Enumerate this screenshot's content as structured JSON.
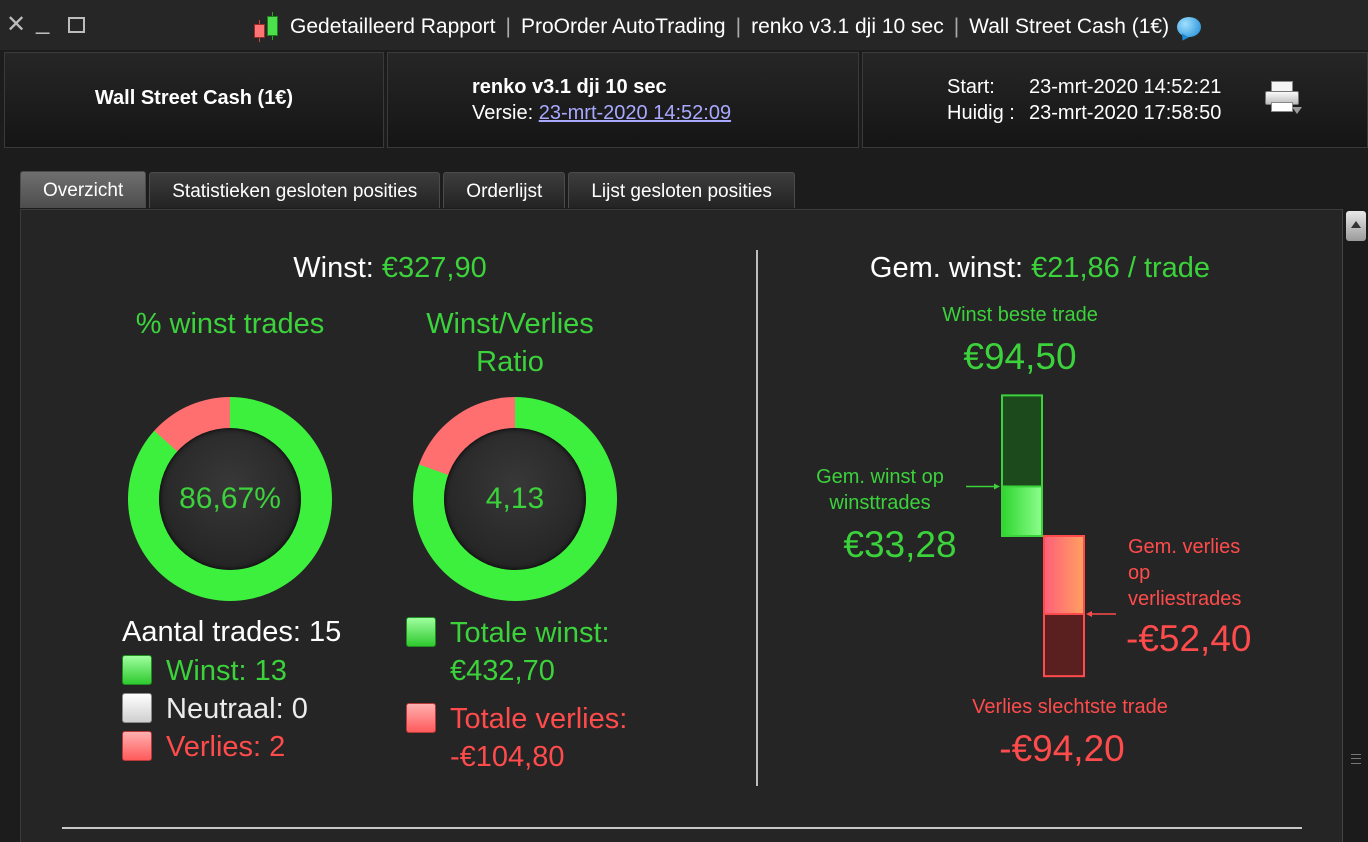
{
  "window": {
    "title_parts": [
      "Gedetailleerd Rapport",
      "ProOrder AutoTrading",
      "renko v3.1 dji 10 sec",
      "Wall Street Cash (1€)"
    ],
    "separator": "|"
  },
  "header": {
    "instrument": "Wall Street Cash (1€)",
    "strategy_name": "renko v3.1 dji 10 sec",
    "version_label": "Versie:",
    "version_value": "23-mrt-2020 14:52:09",
    "start_label": "Start:",
    "start_value": "23-mrt-2020 14:52:21",
    "current_label": "Huidig :",
    "current_value": "23-mrt-2020 17:58:50"
  },
  "tabs": [
    {
      "label": "Overzicht",
      "active": true
    },
    {
      "label": "Statistieken gesloten posities",
      "active": false
    },
    {
      "label": "Orderlijst",
      "active": false
    },
    {
      "label": "Lijst gesloten posities",
      "active": false
    }
  ],
  "summary": {
    "profit_label": "Winst:",
    "profit_value": "€327,90",
    "pct_title": "% winst trades",
    "pct_value": "86,67%",
    "pct_fraction": 0.8667,
    "ratio_title": "Winst/Verlies Ratio",
    "ratio_value": "4,13",
    "ratio_win_fraction": 0.805,
    "trades_label": "Aantal trades: 15",
    "wins_label": "Winst: 13",
    "neutral_label": "Neutraal: 0",
    "losses_label": "Verlies: 2",
    "total_win_label": "Totale winst:",
    "total_win_value": "€432,70",
    "total_loss_label": "Totale verlies:",
    "total_loss_value": "-€104,80"
  },
  "avg": {
    "title_label": "Gem. winst:",
    "title_value": "€21,86 / trade",
    "best_label": "Winst beste trade",
    "best_value": "€94,50",
    "best_amount": 94.5,
    "avg_win_label_1": "Gem. winst op",
    "avg_win_label_2": "winsttrades",
    "avg_win_value": "€33,28",
    "avg_win_amount": 33.28,
    "avg_loss_label_1": "Gem. verlies",
    "avg_loss_label_2": "op",
    "avg_loss_label_3": "verliestrades",
    "avg_loss_value": "-€52,40",
    "avg_loss_amount": -52.4,
    "worst_label": "Verlies slechtste trade",
    "worst_value": "-€94,20",
    "worst_amount": -94.2
  },
  "colors": {
    "green": "#3bd23b",
    "red": "#ff4b4b",
    "ring_green": "#3ef03e",
    "ring_red": "#ff6f6f"
  }
}
